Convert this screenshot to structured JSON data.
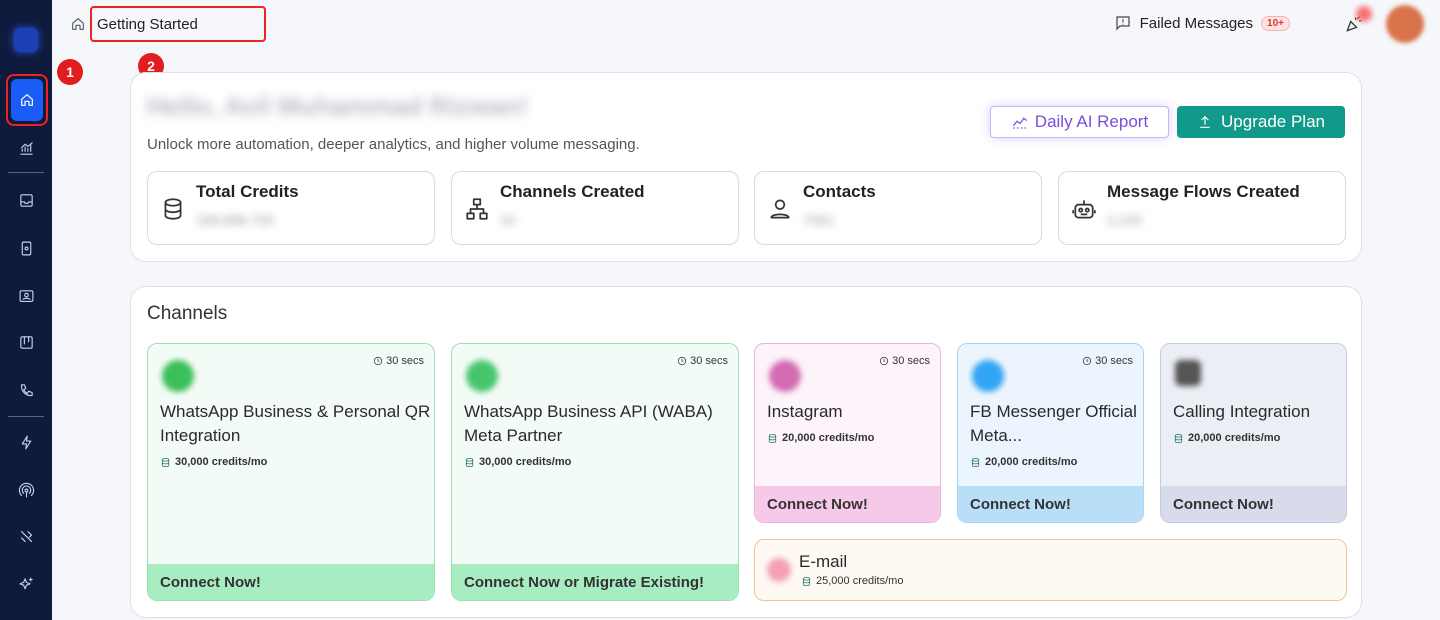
{
  "breadcrumb": {
    "label": "Getting Started"
  },
  "markers": [
    "1",
    "2"
  ],
  "topbar": {
    "failed_label": "Failed Messages",
    "failed_count": "10+"
  },
  "welcome": {
    "greeting": "Hello, Avil Muhammad Rizwan!",
    "subtitle": "Unlock more automation, deeper analytics, and higher volume messaging.",
    "ai_report_label": "Daily AI Report",
    "upgrade_label": "Upgrade Plan"
  },
  "stats": [
    {
      "title": "Total Credits",
      "value": "189,888,750",
      "icon": "database-icon"
    },
    {
      "title": "Channels Created",
      "value": "10",
      "icon": "hierarchy-icon"
    },
    {
      "title": "Contacts",
      "value": "7561",
      "icon": "user-icon"
    },
    {
      "title": "Message Flows Created",
      "value": "2,220",
      "icon": "robot-icon"
    }
  ],
  "channels": {
    "title": "Channels",
    "cards": [
      {
        "name": "WhatsApp Business & Personal QR Integration",
        "time": "30 secs",
        "credits": "30,000 credits/mo",
        "cta": "Connect Now!",
        "icon": "whatsapp-icon"
      },
      {
        "name": "WhatsApp Business API (WABA) Meta Partner",
        "time": "30 secs",
        "credits": "30,000 credits/mo",
        "cta": "Connect Now or Migrate Existing!",
        "icon": "whatsapp-api-icon"
      },
      {
        "name": "Instagram",
        "time": "30 secs",
        "credits": "20,000 credits/mo",
        "cta": "Connect Now!",
        "icon": "instagram-icon"
      },
      {
        "name": "FB Messenger Official Meta...",
        "time": "30 secs",
        "credits": "20,000 credits/mo",
        "cta": "Connect Now!",
        "icon": "messenger-icon"
      },
      {
        "name": "Calling Integration",
        "time": "",
        "credits": "20,000 credits/mo",
        "cta": "Connect Now!",
        "icon": "phone-icon"
      },
      {
        "name": "E-mail",
        "time": "",
        "credits": "25,000 credits/mo",
        "cta": "",
        "icon": "email-icon"
      }
    ]
  },
  "colors": {
    "sidebar": "#0f1b3d",
    "active": "#1a5cf5",
    "upgrade": "#11998a",
    "ai_report": "#7c4ddb",
    "marker": "#e11d1d"
  }
}
